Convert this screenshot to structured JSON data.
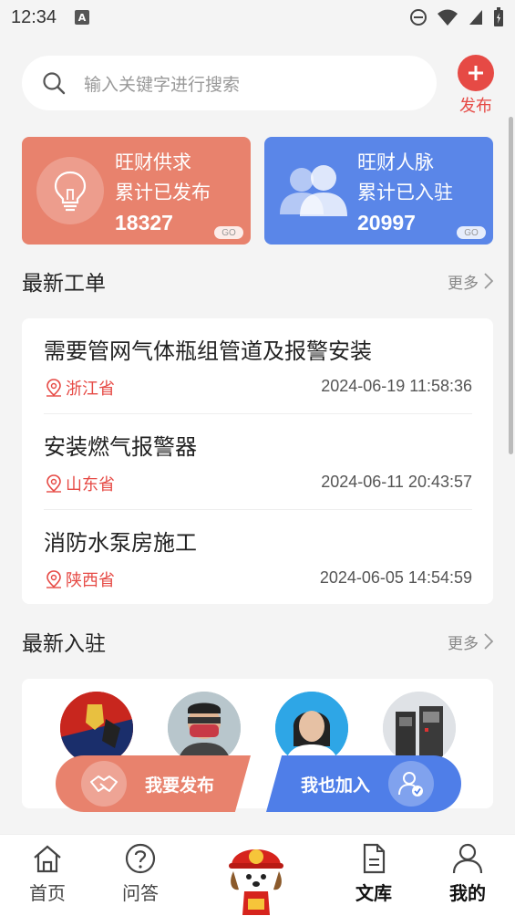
{
  "status_bar": {
    "time": "12:34",
    "a_badge": "A"
  },
  "search": {
    "placeholder": "输入关键字进行搜索"
  },
  "publish": {
    "label": "发布"
  },
  "stats": [
    {
      "title": "旺财供求",
      "subtitle": "累计已发布",
      "count": "18327",
      "go": "GO",
      "color": "#e8826d"
    },
    {
      "title": "旺财人脉",
      "subtitle": "累计已入驻",
      "count": "20997",
      "go": "GO",
      "color": "#5a86e8"
    }
  ],
  "orders_section": {
    "title": "最新工单",
    "more": "更多"
  },
  "orders": [
    {
      "title": "需要管网气体瓶组管道及报警安装",
      "location": "浙江省",
      "time": "2024-06-19 11:58:36"
    },
    {
      "title": "安装燃气报警器",
      "location": "山东省",
      "time": "2024-06-11 20:43:57"
    },
    {
      "title": "消防水泵房施工",
      "location": "陕西省",
      "time": "2024-06-05 14:54:59"
    }
  ],
  "members_section": {
    "title": "最新入驻",
    "more": "更多"
  },
  "float_actions": {
    "publish": "我要发布",
    "join": "我也加入"
  },
  "nav": [
    {
      "label": "首页",
      "icon": "home-icon"
    },
    {
      "label": "问答",
      "icon": "question-icon"
    },
    {
      "label": "",
      "icon": "mascot-icon"
    },
    {
      "label": "文库",
      "icon": "document-icon"
    },
    {
      "label": "我的",
      "icon": "user-icon"
    }
  ],
  "colors": {
    "accent_red": "#e64a45",
    "supply": "#e8826d",
    "people": "#5a86e8"
  }
}
